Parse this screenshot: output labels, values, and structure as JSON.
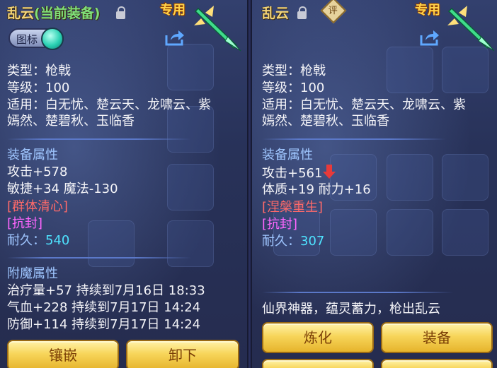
{
  "left": {
    "title_main": "乱云",
    "title_suffix": "(当前装备)",
    "badge": "专用",
    "icon_toggle_label": "图标",
    "type_line": "类型：枪戟",
    "level_line": "等级：100",
    "fit_line1": "适用：白无忧、楚云天、龙啸云、紫",
    "fit_line2": "嫣然、楚碧秋、玉临香",
    "attr_header": "装备属性",
    "attack": "攻击+578",
    "agility_magic": "敏捷+34 魔法-130",
    "special1": "[群体清心]",
    "special2": "[抗封]",
    "durability_label": "耐久：",
    "durability_value": "540",
    "enchant_header": "附魔属性",
    "enchant1": "治疗量+57 持续到7月16日 18:33",
    "enchant2": "气血+228 持续到7月17日 14:24",
    "enchant3": "防御+114 持续到7月17日 14:24",
    "btn_inlay": "镶嵌",
    "btn_unequip": "卸下"
  },
  "right": {
    "title_main": "乱云",
    "eval_label": "评",
    "badge": "专用",
    "type_line": "类型：枪戟",
    "level_line": "等级：100",
    "fit_line1": "适用：白无忧、楚云天、龙啸云、紫",
    "fit_line2": "嫣然、楚碧秋、玉临香",
    "attr_header": "装备属性",
    "attack": "攻击+561",
    "physique_endurance": "体质+19 耐力+16",
    "special1": "[涅槃重生]",
    "special2": "[抗封]",
    "durability_label": "耐久：",
    "durability_value": "307",
    "description": "仙界神器，蕴灵蓄力，枪出乱云",
    "btn_refine": "炼化",
    "btn_equip": "装备"
  }
}
